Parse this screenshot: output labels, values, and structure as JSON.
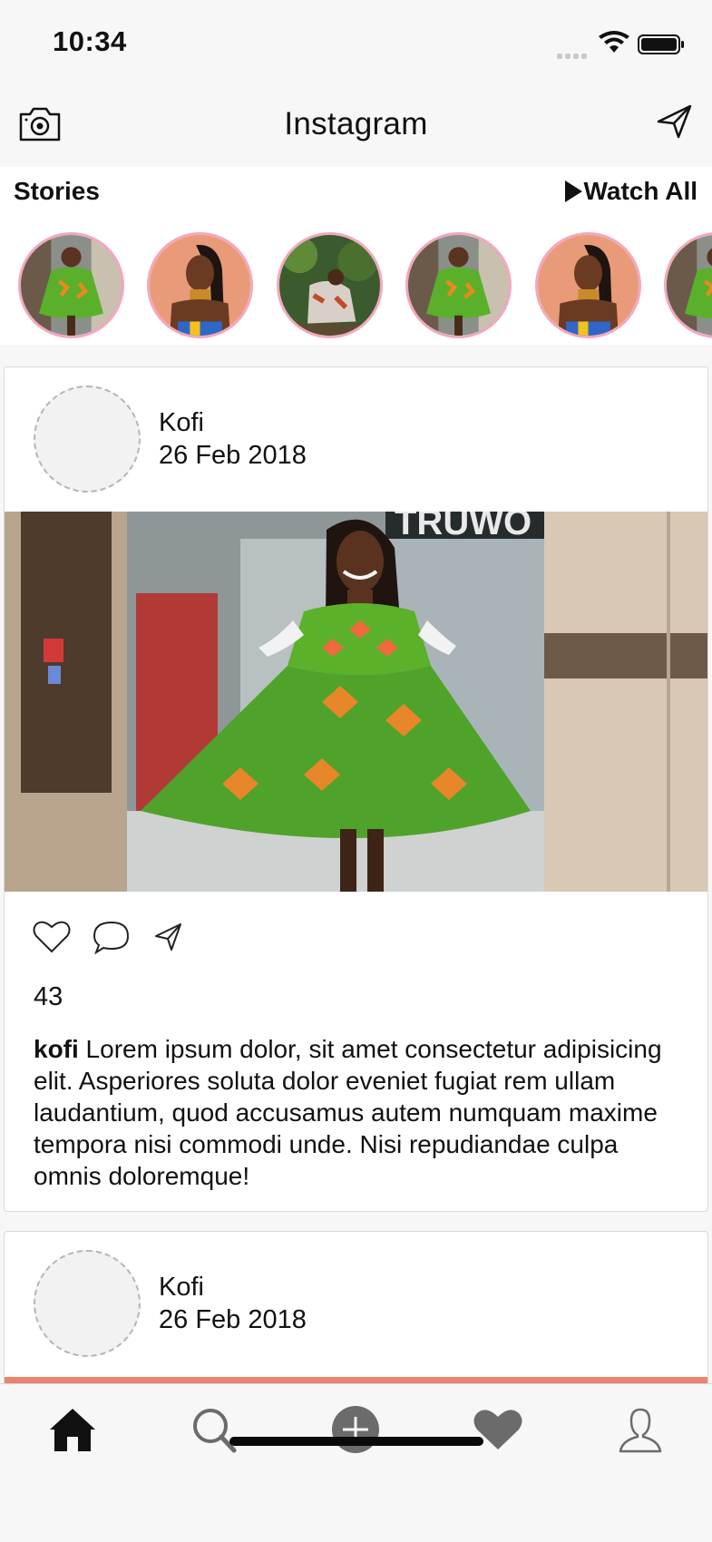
{
  "status_bar": {
    "time": "10:34"
  },
  "nav": {
    "title": "Instagram"
  },
  "stories": {
    "label": "Stories",
    "watch_all": "Watch All",
    "items": [
      "story-dress",
      "story-portrait",
      "story-garden",
      "story-dress",
      "story-portrait",
      "story-dress"
    ]
  },
  "posts": [
    {
      "username": "Kofi",
      "date": "26 Feb 2018",
      "likes": "43",
      "caption_user": "kofi",
      "caption_text": " Lorem ipsum dolor, sit amet consectetur adipisicing elit. Asperiores soluta dolor eveniet fugiat rem ullam laudantium, quod accusamus autem numquam maxime tempora nisi commodi unde. Nisi repudiandae culpa omnis doloremque!",
      "storefront_text": "TRUWO"
    },
    {
      "username": "Kofi",
      "date": "26 Feb 2018"
    }
  ],
  "tab_bar": {
    "tabs": [
      "home-icon",
      "search-icon",
      "add-icon",
      "heart-icon",
      "profile-icon"
    ]
  },
  "colors": {
    "story_ring": "#f3a8bd",
    "background": "#f7f7f7",
    "card": "#ffffff"
  }
}
